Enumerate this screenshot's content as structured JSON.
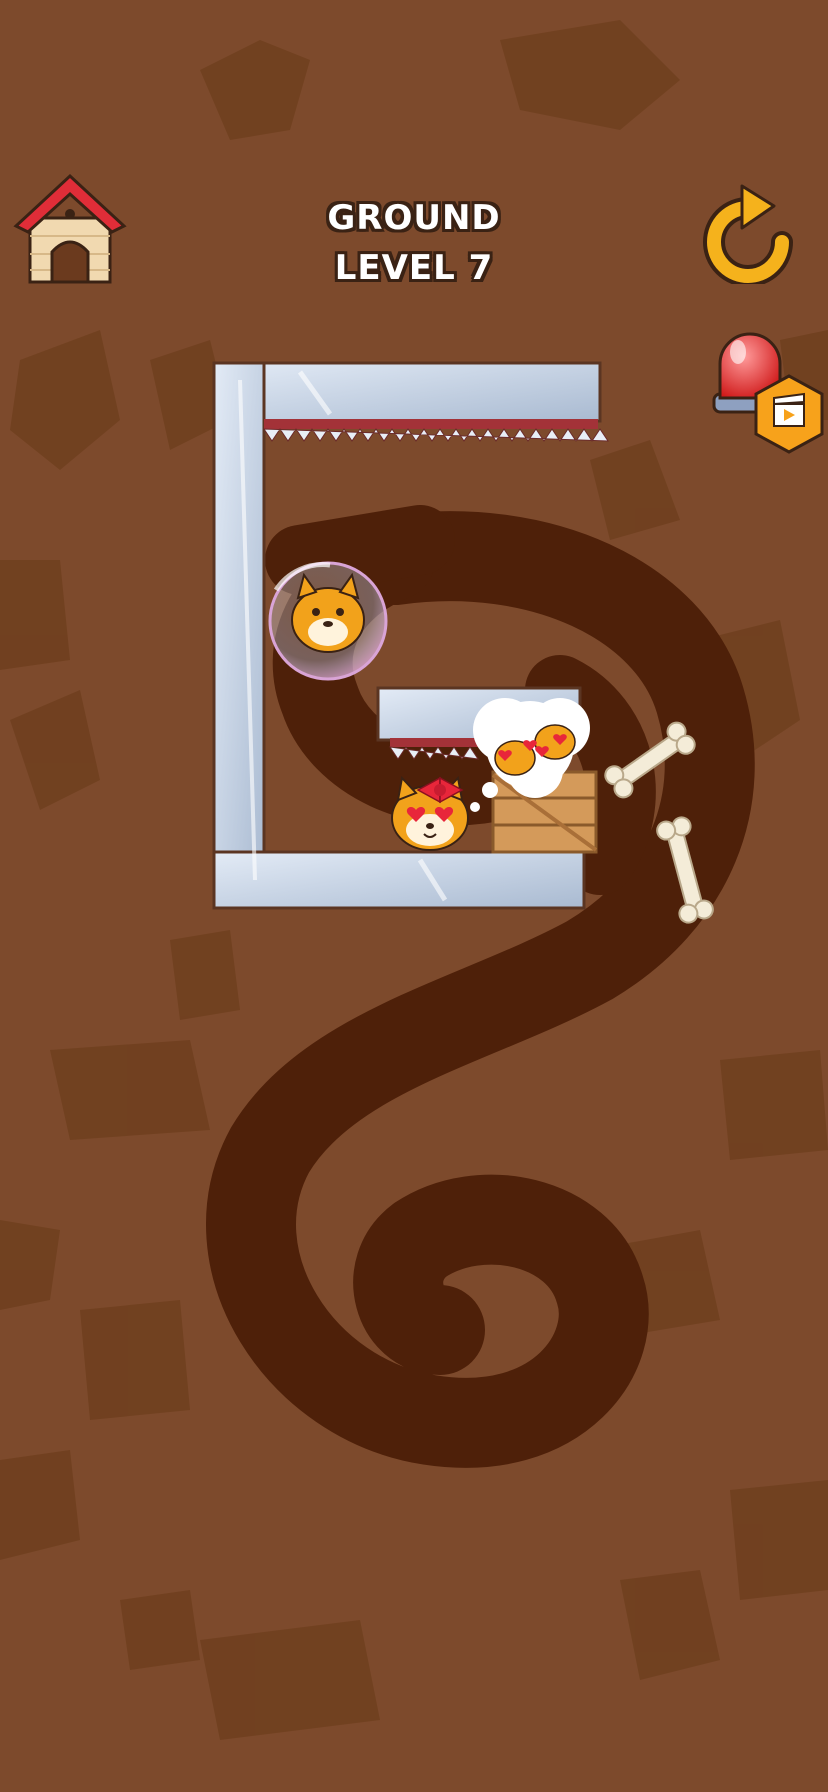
{
  "header": {
    "world_name": "GROUND",
    "level_label": "LEVEL 7"
  },
  "buttons": {
    "home": "home-icon",
    "restart": "restart-icon",
    "hint": "alarm-hint-icon",
    "hint_badge": "video-ad-icon"
  },
  "colors": {
    "background": "#7d4a2c",
    "tunnel": "#4e2009",
    "glass": "#c8d6e8",
    "accent_orange": "#f2a21b"
  }
}
